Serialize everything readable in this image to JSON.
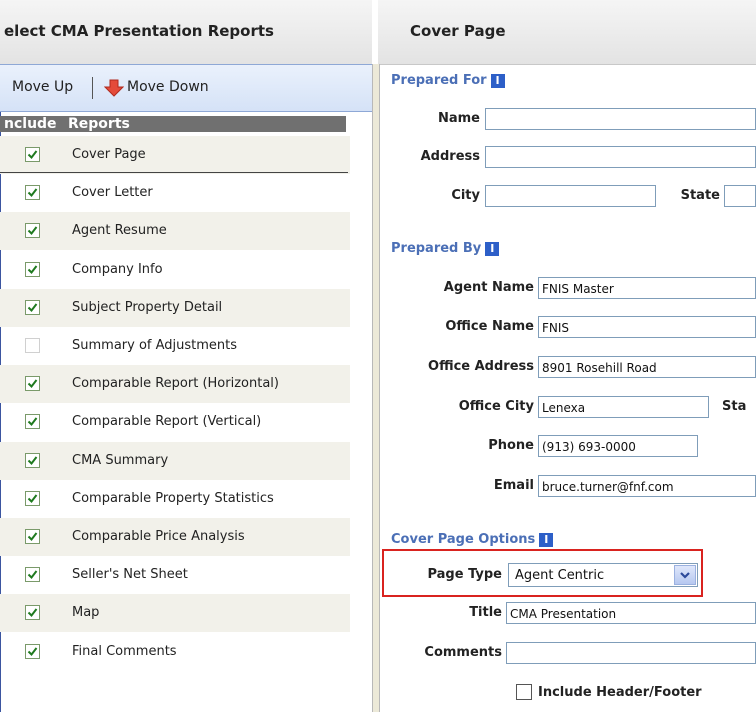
{
  "left_panel": {
    "title": "elect CMA Presentation Reports",
    "toolbar": {
      "move_up": "Move Up",
      "move_down": "Move Down"
    },
    "columns": {
      "include": "nclude",
      "reports": "Reports"
    },
    "reports": [
      {
        "label": "Cover Page",
        "checked": true
      },
      {
        "label": "Cover Letter",
        "checked": true
      },
      {
        "label": "Agent Resume",
        "checked": true
      },
      {
        "label": "Company Info",
        "checked": true
      },
      {
        "label": "Subject Property Detail",
        "checked": true
      },
      {
        "label": "Summary of Adjustments",
        "checked": false
      },
      {
        "label": "Comparable Report (Horizontal)",
        "checked": true
      },
      {
        "label": "Comparable Report (Vertical)",
        "checked": true
      },
      {
        "label": "CMA Summary",
        "checked": true
      },
      {
        "label": "Comparable Property Statistics",
        "checked": true
      },
      {
        "label": "Comparable Price Analysis",
        "checked": true
      },
      {
        "label": "Seller's Net Sheet",
        "checked": true
      },
      {
        "label": "Map",
        "checked": true
      },
      {
        "label": "Final Comments",
        "checked": true
      }
    ]
  },
  "right_panel": {
    "title": "Cover Page",
    "prepared_for": {
      "heading": "Prepared For",
      "name_label": "Name",
      "name_value": "",
      "address_label": "Address",
      "address_value": "",
      "city_label": "City",
      "city_value": "",
      "state_label": "State",
      "state_value": ""
    },
    "prepared_by": {
      "heading": "Prepared By",
      "agent_name_label": "Agent Name",
      "agent_name_value": "FNIS Master",
      "office_name_label": "Office Name",
      "office_name_value": "FNIS",
      "office_address_label": "Office Address",
      "office_address_value": "8901 Rosehill Road",
      "office_city_label": "Office City",
      "office_city_value": "Lenexa",
      "office_state_label": "Sta",
      "phone_label": "Phone",
      "phone_value": "(913) 693-0000",
      "email_label": "Email",
      "email_value": "bruce.turner@fnf.com"
    },
    "cover_page_options": {
      "heading": "Cover Page Options",
      "page_type_label": "Page Type",
      "page_type_value": "Agent Centric",
      "title_label": "Title",
      "title_value": "CMA Presentation",
      "comments_label": "Comments",
      "comments_value": "",
      "include_header_footer_label": "Include Header/Footer"
    }
  },
  "colors": {
    "accent": "#4b6fb6",
    "highlight": "#d9231f",
    "info_icon": "#2d5fc8",
    "toolbar": "#d5e2f7"
  },
  "icons": {
    "info": "I",
    "move_down": "red-down-arrow",
    "dropdown": "chevron-down",
    "check": "checkmark"
  }
}
